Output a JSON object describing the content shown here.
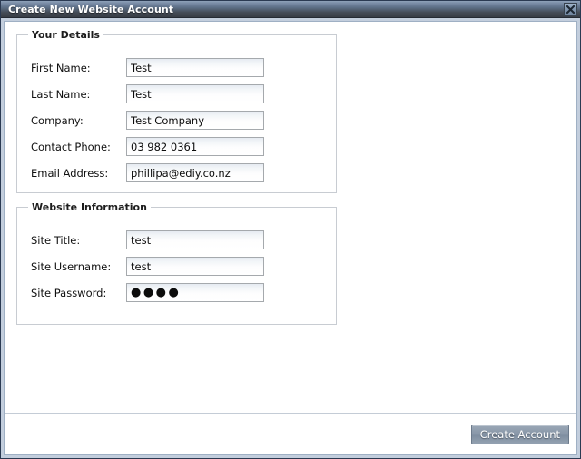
{
  "window": {
    "title": "Create New Website Account",
    "close_icon": "close-icon",
    "close_glyph": "✖"
  },
  "groups": [
    {
      "legend": "Your Details",
      "fields": [
        {
          "label": "First Name:",
          "value": "Test",
          "type": "text"
        },
        {
          "label": "Last Name:",
          "value": "Test",
          "type": "text"
        },
        {
          "label": "Company:",
          "value": "Test Company",
          "type": "text"
        },
        {
          "label": "Contact Phone:",
          "value": "03 982 0361",
          "type": "text"
        },
        {
          "label": "Email Address:",
          "value": "phillipa@ediy.co.nz",
          "type": "text"
        }
      ]
    },
    {
      "legend": "Website Information",
      "fields": [
        {
          "label": "Site Title:",
          "value": "test",
          "type": "text"
        },
        {
          "label": "Site Username:",
          "value": "test",
          "type": "text"
        },
        {
          "label": "Site Password:",
          "value": "●●●●",
          "type": "password"
        }
      ]
    }
  ],
  "footer": {
    "submit_label": "Create Account"
  },
  "colors": {
    "titlebar_top": "#8fa2ba",
    "titlebar_bottom": "#383d45",
    "window_frame": "#c3cedd",
    "window_border": "#2b3a52",
    "content_background": "#ffffff",
    "fieldset_border": "#c8ccd2",
    "input_border": "#a5a9ad",
    "button_face": "#8a98a9",
    "button_text": "#ffffff",
    "label_text": "#101010"
  }
}
